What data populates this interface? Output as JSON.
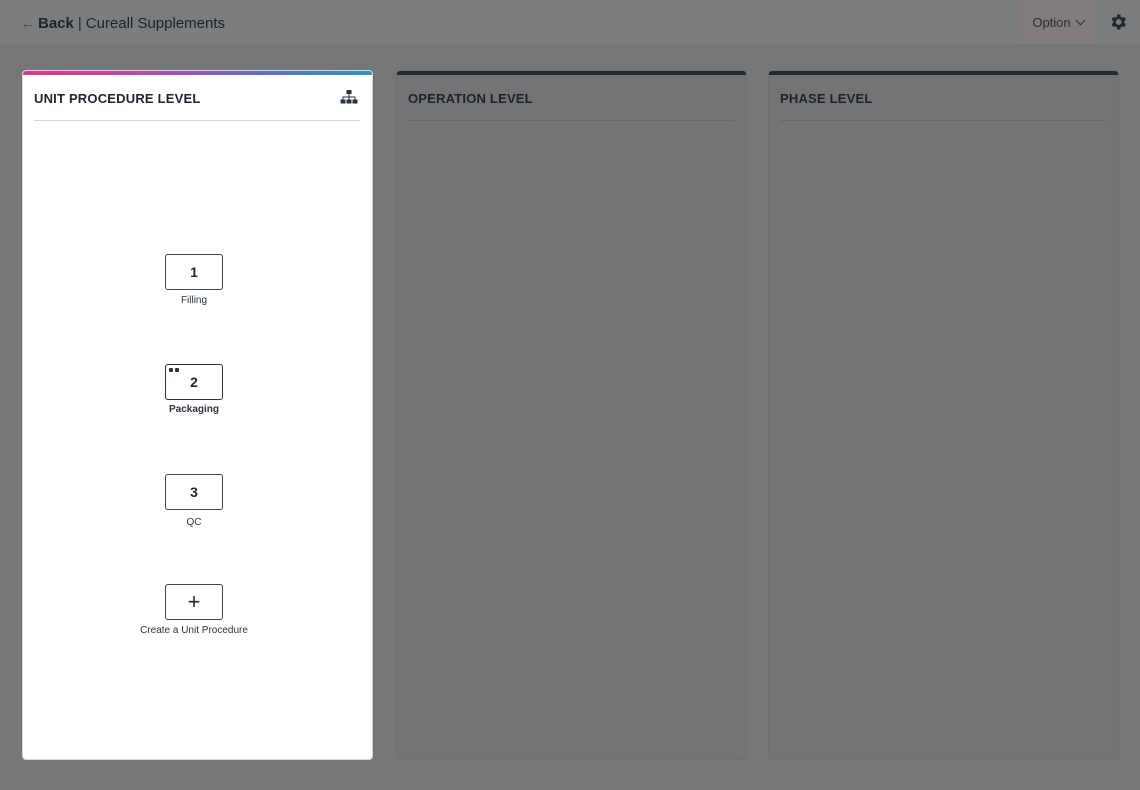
{
  "header": {
    "back_arrow": "←",
    "back_label": "Back",
    "separator": "|",
    "app_title": "Cureall Supplements",
    "option_label": "Option"
  },
  "icons": {
    "back": "arrow-left-icon",
    "option": "chevron-down-icon",
    "settings": "gear-icon",
    "hierarchy": "hierarchy-icon",
    "add": "plus-icon"
  },
  "colors": {
    "accent_gradient": [
      "#e0358d",
      "#b44ba8",
      "#5f6fbe",
      "#2a9bb3"
    ],
    "back_arrow": "#6e2a4b",
    "overlay": "#757677"
  },
  "panels": {
    "unit_procedure": {
      "title": "UNIT PROCEDURE LEVEL",
      "steps": [
        {
          "number": "1",
          "label": "Filling"
        },
        {
          "number": "2",
          "label": "Packaging"
        },
        {
          "number": "3",
          "label": "QC"
        }
      ],
      "create_label": "Create a Unit Procedure",
      "create_symbol": "+"
    },
    "operation": {
      "title": "OPERATION LEVEL"
    },
    "phase": {
      "title": "PHASE LEVEL"
    }
  }
}
